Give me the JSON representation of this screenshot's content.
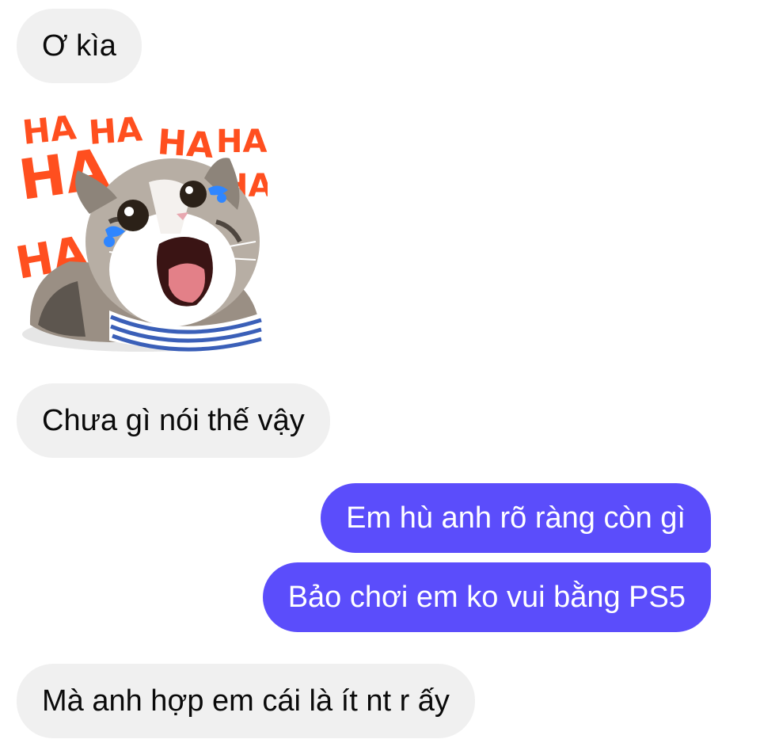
{
  "conversation": {
    "messages": [
      {
        "sender": "other",
        "type": "text",
        "text": "Ơ kìa"
      },
      {
        "sender": "other",
        "type": "sticker",
        "sticker_icon": "laughing-cat-sticker",
        "caption_text": "HA HA HA HA HA HA HA"
      },
      {
        "sender": "other",
        "type": "text",
        "text": "Chưa gì nói thế vậy"
      },
      {
        "sender": "me",
        "type": "text",
        "text": "Em hù anh rõ ràng còn gì"
      },
      {
        "sender": "me",
        "type": "text",
        "text": "Bảo chơi em ko vui bằng PS5"
      },
      {
        "sender": "other",
        "type": "text",
        "text": "Mà anh hợp em cái là ít nt r ấy"
      }
    ]
  },
  "colors": {
    "incoming_bubble": "#f0f0f0",
    "outgoing_bubble": "#5b4dfb",
    "sticker_text": "#ff4f1f",
    "tear": "#2f86ff"
  }
}
